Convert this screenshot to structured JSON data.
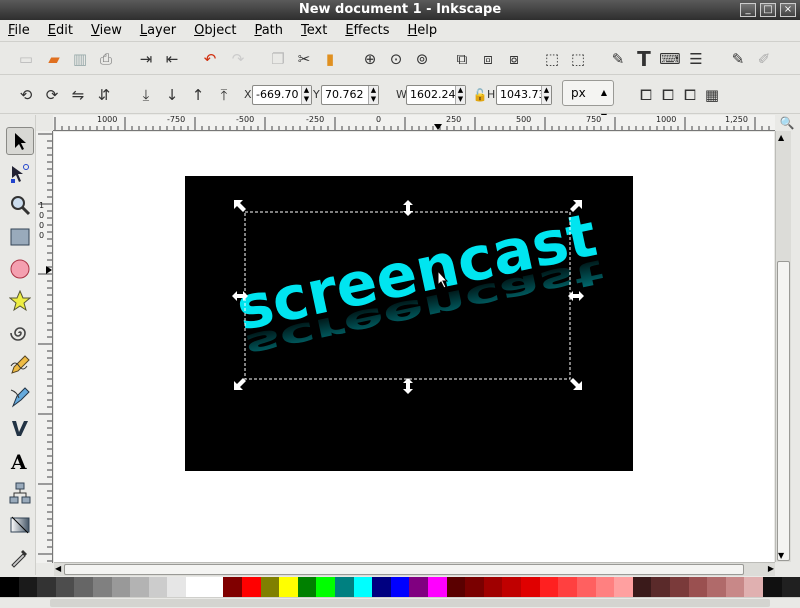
{
  "window": {
    "title": "New document 1 - Inkscape"
  },
  "menus": [
    {
      "label": "File",
      "key": "F",
      "rest": "ile"
    },
    {
      "label": "Edit",
      "key": "E",
      "rest": "dit"
    },
    {
      "label": "View",
      "key": "V",
      "rest": "iew"
    },
    {
      "label": "Layer",
      "key": "L",
      "rest": "ayer"
    },
    {
      "label": "Object",
      "key": "O",
      "rest": "bject"
    },
    {
      "label": "Path",
      "key": "P",
      "rest": "ath"
    },
    {
      "label": "Text",
      "key": "T",
      "rest": "ext"
    },
    {
      "label": "Effects",
      "key": "E",
      "rest": "ffects"
    },
    {
      "label": "Help",
      "key": "H",
      "rest": "elp"
    }
  ],
  "controls": {
    "x_label": "X",
    "x_value": "-669.70",
    "y_label": "Y",
    "y_value": "70.762",
    "w_label": "W",
    "w_value": "1602.24",
    "h_label": "H",
    "h_value": "1043.73",
    "unit": "px"
  },
  "ruler": {
    "h_labels": [
      "1000",
      "-750",
      "-500",
      "-250",
      "0",
      "250",
      "500",
      "750",
      "1000",
      "1,250"
    ],
    "v_labels": [
      "1",
      "0",
      "0",
      "0"
    ]
  },
  "canvas_text": "screencast",
  "colors": {
    "accent_text": "#00e5f0",
    "page": "#000000"
  },
  "palette": [
    "#000000",
    "#1a1a1a",
    "#333333",
    "#4d4d4d",
    "#666666",
    "#808080",
    "#999999",
    "#b3b3b3",
    "#cccccc",
    "#e6e6e6",
    "#ffffff",
    "#ffffff",
    "#800000",
    "#ff0000",
    "#808000",
    "#ffff00",
    "#008000",
    "#00ff00",
    "#008080",
    "#00ffff",
    "#000080",
    "#0000ff",
    "#800080",
    "#ff00ff",
    "#5a0000",
    "#7a0000",
    "#a00000",
    "#c00000",
    "#e00000",
    "#ff2020",
    "#ff4040",
    "#ff6060",
    "#ff8080",
    "#ffa0a0",
    "#3a1a1a",
    "#5a2a2a",
    "#7a3a3a",
    "#9a5050",
    "#b06a6a",
    "#c88888",
    "#e0b0b0",
    "#101010",
    "#202020"
  ]
}
